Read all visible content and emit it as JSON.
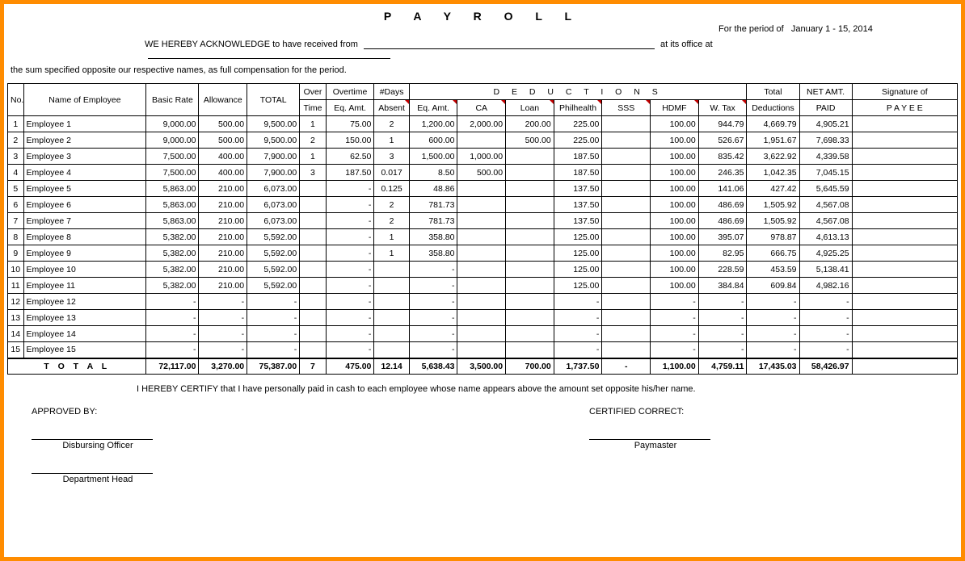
{
  "title": "P A Y R O L L",
  "period_prefix": "For the period of",
  "period_value": "January 1 - 15,  2014",
  "ack_prefix": "WE HEREBY ACKNOWLEDGE to have received from",
  "ack_mid": "at its office at",
  "sum_text": "the sum specified opposite our respective names, as full compensation for the period.",
  "headers": {
    "no": "No.",
    "name": "Name of Employee",
    "basic": "Basic Rate",
    "allow": "Allowance",
    "total": "TOTAL",
    "over": "Over",
    "overtime": "Overtime",
    "time": "Time",
    "eqamt": "Eq. Amt.",
    "days": "#Days",
    "absent": "Absent",
    "deductions": "D  E  D  U  C  T  I  O  N  S",
    "ded_eq": "Eq. Amt.",
    "ca": "CA",
    "loan": "Loan",
    "phil": "Philhealth",
    "sss": "SSS",
    "hdmf": "HDMF",
    "wtax": "W. Tax",
    "tded_top": "Total",
    "tded_bot": "Deductions",
    "net_top": "NET AMT.",
    "net_bot": "PAID",
    "sig_top": "Signature of",
    "sig_bot": "P A Y E E"
  },
  "rows": [
    {
      "no": "1",
      "name": "Employee 1",
      "basic": "9,000.00",
      "allow": "500.00",
      "total": "9,500.00",
      "ot": "1",
      "oteq": "75.00",
      "days": "2",
      "deq": "1,200.00",
      "ca": "2,000.00",
      "loan": "200.00",
      "phil": "225.00",
      "sss": "",
      "hdmf": "100.00",
      "wtax": "944.79",
      "tded": "4,669.79",
      "net": "4,905.21"
    },
    {
      "no": "2",
      "name": "Employee 2",
      "basic": "9,000.00",
      "allow": "500.00",
      "total": "9,500.00",
      "ot": "2",
      "oteq": "150.00",
      "days": "1",
      "deq": "600.00",
      "ca": "",
      "loan": "500.00",
      "phil": "225.00",
      "sss": "",
      "hdmf": "100.00",
      "wtax": "526.67",
      "tded": "1,951.67",
      "net": "7,698.33"
    },
    {
      "no": "3",
      "name": "Employee 3",
      "basic": "7,500.00",
      "allow": "400.00",
      "total": "7,900.00",
      "ot": "1",
      "oteq": "62.50",
      "days": "3",
      "deq": "1,500.00",
      "ca": "1,000.00",
      "loan": "",
      "phil": "187.50",
      "sss": "",
      "hdmf": "100.00",
      "wtax": "835.42",
      "tded": "3,622.92",
      "net": "4,339.58"
    },
    {
      "no": "4",
      "name": "Employee 4",
      "basic": "7,500.00",
      "allow": "400.00",
      "total": "7,900.00",
      "ot": "3",
      "oteq": "187.50",
      "days": "0.017",
      "deq": "8.50",
      "ca": "500.00",
      "loan": "",
      "phil": "187.50",
      "sss": "",
      "hdmf": "100.00",
      "wtax": "246.35",
      "tded": "1,042.35",
      "net": "7,045.15"
    },
    {
      "no": "5",
      "name": "Employee 5",
      "basic": "5,863.00",
      "allow": "210.00",
      "total": "6,073.00",
      "ot": "",
      "oteq": "-",
      "days": "0.125",
      "deq": "48.86",
      "ca": "",
      "loan": "",
      "phil": "137.50",
      "sss": "",
      "hdmf": "100.00",
      "wtax": "141.06",
      "tded": "427.42",
      "net": "5,645.59"
    },
    {
      "no": "6",
      "name": "Employee 6",
      "basic": "5,863.00",
      "allow": "210.00",
      "total": "6,073.00",
      "ot": "",
      "oteq": "-",
      "days": "2",
      "deq": "781.73",
      "ca": "",
      "loan": "",
      "phil": "137.50",
      "sss": "",
      "hdmf": "100.00",
      "wtax": "486.69",
      "tded": "1,505.92",
      "net": "4,567.08"
    },
    {
      "no": "7",
      "name": "Employee 7",
      "basic": "5,863.00",
      "allow": "210.00",
      "total": "6,073.00",
      "ot": "",
      "oteq": "-",
      "days": "2",
      "deq": "781.73",
      "ca": "",
      "loan": "",
      "phil": "137.50",
      "sss": "",
      "hdmf": "100.00",
      "wtax": "486.69",
      "tded": "1,505.92",
      "net": "4,567.08"
    },
    {
      "no": "8",
      "name": "Employee 8",
      "basic": "5,382.00",
      "allow": "210.00",
      "total": "5,592.00",
      "ot": "",
      "oteq": "-",
      "days": "1",
      "deq": "358.80",
      "ca": "",
      "loan": "",
      "phil": "125.00",
      "sss": "",
      "hdmf": "100.00",
      "wtax": "395.07",
      "tded": "978.87",
      "net": "4,613.13"
    },
    {
      "no": "9",
      "name": "Employee 9",
      "basic": "5,382.00",
      "allow": "210.00",
      "total": "5,592.00",
      "ot": "",
      "oteq": "-",
      "days": "1",
      "deq": "358.80",
      "ca": "",
      "loan": "",
      "phil": "125.00",
      "sss": "",
      "hdmf": "100.00",
      "wtax": "82.95",
      "tded": "666.75",
      "net": "4,925.25"
    },
    {
      "no": "10",
      "name": "Employee 10",
      "basic": "5,382.00",
      "allow": "210.00",
      "total": "5,592.00",
      "ot": "",
      "oteq": "-",
      "days": "",
      "deq": "-",
      "ca": "",
      "loan": "",
      "phil": "125.00",
      "sss": "",
      "hdmf": "100.00",
      "wtax": "228.59",
      "tded": "453.59",
      "net": "5,138.41"
    },
    {
      "no": "11",
      "name": "Employee 11",
      "basic": "5,382.00",
      "allow": "210.00",
      "total": "5,592.00",
      "ot": "",
      "oteq": "-",
      "days": "",
      "deq": "-",
      "ca": "",
      "loan": "",
      "phil": "125.00",
      "sss": "",
      "hdmf": "100.00",
      "wtax": "384.84",
      "tded": "609.84",
      "net": "4,982.16"
    },
    {
      "no": "12",
      "name": "Employee 12",
      "basic": "-",
      "allow": "-",
      "total": "-",
      "ot": "",
      "oteq": "-",
      "days": "",
      "deq": "-",
      "ca": "",
      "loan": "",
      "phil": "-",
      "sss": "",
      "hdmf": "-",
      "wtax": "-",
      "tded": "-",
      "net": "-"
    },
    {
      "no": "13",
      "name": "Employee 13",
      "basic": "-",
      "allow": "-",
      "total": "-",
      "ot": "",
      "oteq": "-",
      "days": "",
      "deq": "-",
      "ca": "",
      "loan": "",
      "phil": "-",
      "sss": "",
      "hdmf": "-",
      "wtax": "-",
      "tded": "-",
      "net": "-"
    },
    {
      "no": "14",
      "name": "Employee 14",
      "basic": "-",
      "allow": "-",
      "total": "-",
      "ot": "",
      "oteq": "-",
      "days": "",
      "deq": "-",
      "ca": "",
      "loan": "",
      "phil": "-",
      "sss": "",
      "hdmf": "-",
      "wtax": "-",
      "tded": "-",
      "net": "-"
    },
    {
      "no": "15",
      "name": "Employee 15",
      "basic": "-",
      "allow": "-",
      "total": "-",
      "ot": "",
      "oteq": "-",
      "days": "",
      "deq": "-",
      "ca": "",
      "loan": "",
      "phil": "-",
      "sss": "",
      "hdmf": "-",
      "wtax": "-",
      "tded": "-",
      "net": "-"
    }
  ],
  "totals": {
    "label": "T O T A L",
    "basic": "72,117.00",
    "allow": "3,270.00",
    "total": "75,387.00",
    "ot": "7",
    "oteq": "475.00",
    "days": "12.14",
    "deq": "5,638.43",
    "ca": "3,500.00",
    "loan": "700.00",
    "phil": "1,737.50",
    "sss": "-",
    "hdmf": "1,100.00",
    "wtax": "4,759.11",
    "tded": "17,435.03",
    "net": "58,426.97"
  },
  "certify": "I HEREBY CERTIFY  that I have personally paid in cash to each employee whose name appears above the amount set opposite his/her name.",
  "approved": "APPROVED BY:",
  "certified": "CERTIFIED CORRECT:",
  "disbursing": "Disbursing Officer",
  "paymaster": "Paymaster",
  "depthead": "Department Head"
}
